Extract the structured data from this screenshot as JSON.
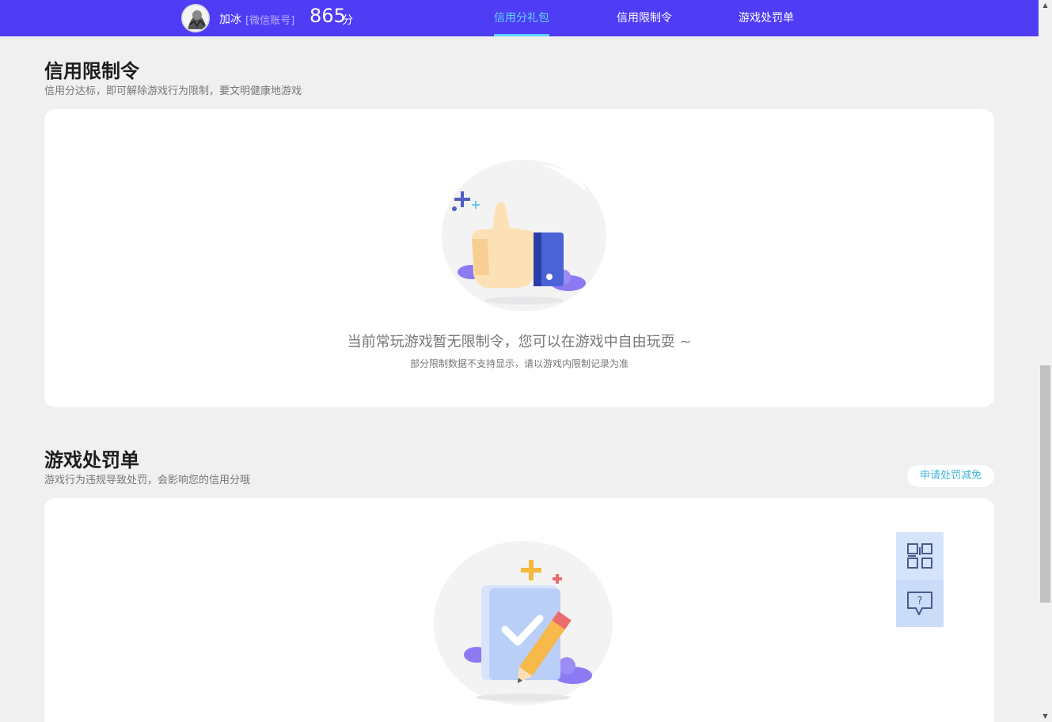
{
  "header": {
    "user_name": "加冰",
    "account_type": "[微信账号]",
    "score": "865",
    "score_unit": "分",
    "tabs": [
      {
        "label": "信用分礼包",
        "active": true
      },
      {
        "label": "信用限制令",
        "active": false
      },
      {
        "label": "游戏处罚单",
        "active": false
      }
    ]
  },
  "restriction_section": {
    "title": "信用限制令",
    "subtitle": "信用分达标，即可解除游戏行为限制，要文明健康地游戏",
    "empty_message": "当前常玩游戏暂无限制令，您可以在游戏中自由玩耍 ~",
    "empty_note": "部分限制数据不支持显示，请以游戏内限制记录为准"
  },
  "penalty_section": {
    "title": "游戏处罚单",
    "subtitle": "游戏行为违规导致处罚，会影响您的信用分哦",
    "appeal_button": "申请处罚减免"
  },
  "side_tools": [
    {
      "icon": "qrcode-icon"
    },
    {
      "icon": "help-chat-icon"
    }
  ],
  "colors": {
    "nav_bg": "#4f3df6",
    "nav_active": "#5fd6ff",
    "page_bg": "#f0f0f0",
    "link": "#3fb7d8"
  }
}
